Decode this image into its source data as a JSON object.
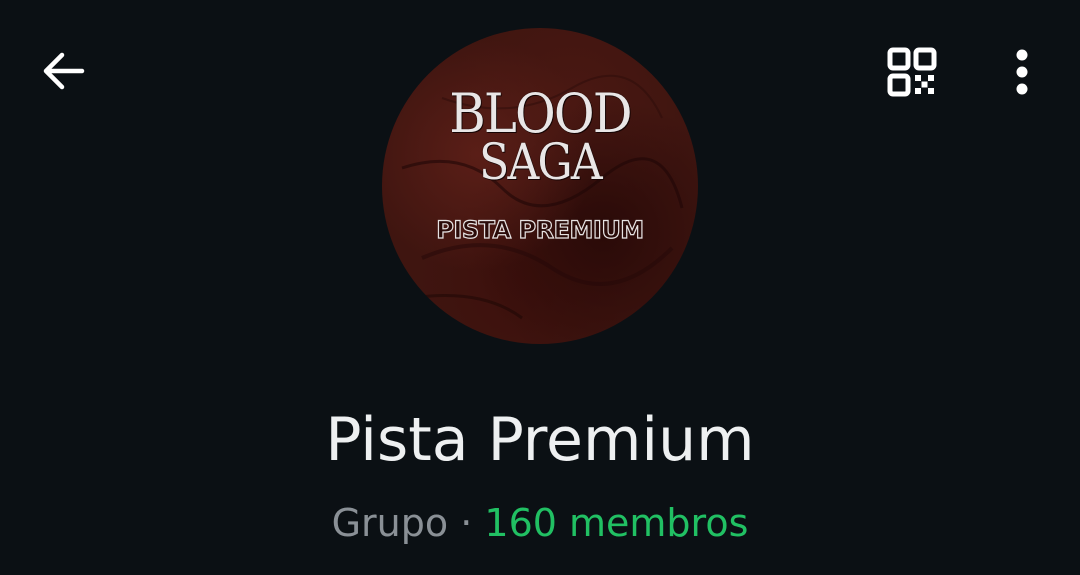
{
  "header": {
    "back_icon": "arrow-left-icon",
    "qr_icon": "qr-code-icon",
    "menu_icon": "more-vertical-icon"
  },
  "avatar": {
    "logo_line1": "BLOOD",
    "logo_line2": "SAGA",
    "logo_subtitle": "PISTA PREMIUM"
  },
  "group": {
    "name": "Pista Premium",
    "kind": "Grupo",
    "separator": " · ",
    "members": "160 membros"
  },
  "colors": {
    "background": "#0b1014",
    "title": "#eef0f1",
    "secondary_text": "#8a9096",
    "accent": "#21c063"
  }
}
